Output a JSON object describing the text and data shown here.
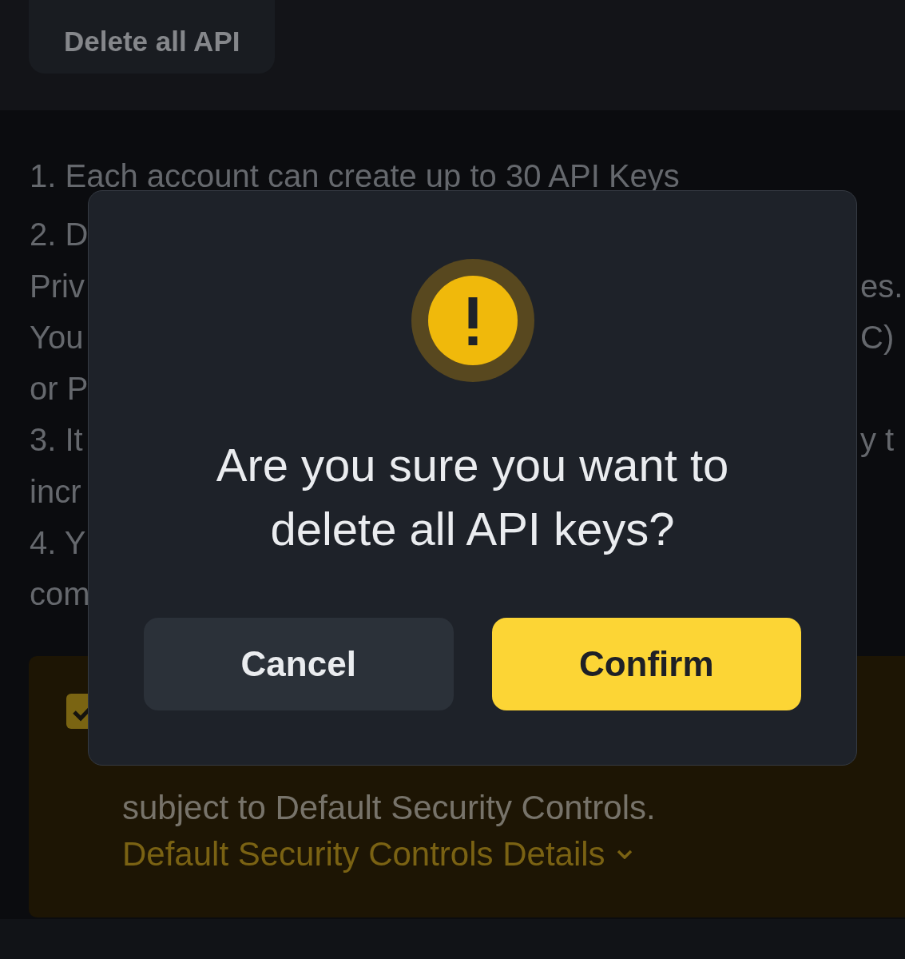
{
  "header": {
    "button": "Delete all API"
  },
  "notes": [
    {
      "left": "1. Each account can create up to 30 API Keys"
    },
    {
      "left": "2. D"
    },
    {
      "left": "Priv",
      "right": "es."
    },
    {
      "left": "You",
      "right": "C)"
    },
    {
      "left": "or P"
    },
    {
      "left": "3. It",
      "right": "y t"
    },
    {
      "left": "incr"
    },
    {
      "left": "4. Y"
    },
    {
      "left": "com"
    }
  ],
  "notice": {
    "checked": true,
    "text": "subject to Default Security Controls.",
    "link": "Default Security Controls Details"
  },
  "dialog": {
    "title": "Are you sure you want to delete all API keys?",
    "buttons": [
      {
        "label": "Cancel",
        "kind": "secondary"
      },
      {
        "label": "Confirm",
        "kind": "primary"
      }
    ]
  }
}
